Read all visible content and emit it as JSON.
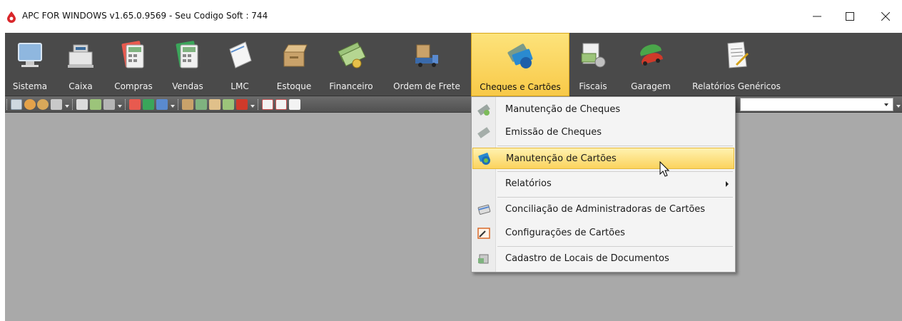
{
  "window": {
    "title": "APC FOR WINDOWS v1.65.0.9569 - Seu Codigo Soft : 744",
    "minimize_glyph": "—",
    "maximize_glyph": "☐",
    "close_glyph": "✕"
  },
  "ribbon": {
    "items": [
      {
        "label": "Sistema",
        "icon": "computer-icon"
      },
      {
        "label": "Caixa",
        "icon": "cash-register-icon"
      },
      {
        "label": "Compras",
        "icon": "calculator-icon"
      },
      {
        "label": "Vendas",
        "icon": "calculator-icon"
      },
      {
        "label": "LMC",
        "icon": "document-icon"
      },
      {
        "label": "Estoque",
        "icon": "box-icon"
      },
      {
        "label": "Financeiro",
        "icon": "money-icon"
      },
      {
        "label": "Ordem de Frete",
        "icon": "truck-icon"
      },
      {
        "label": "Cheques e Cartões",
        "icon": "cards-icon",
        "active": true
      },
      {
        "label": "Fiscais",
        "icon": "fiscal-documents-icon"
      },
      {
        "label": "Garagem",
        "icon": "cars-icon"
      },
      {
        "label": "Relatórios Genéricos",
        "icon": "report-icon"
      }
    ]
  },
  "menu": {
    "items": [
      {
        "label": "Manutenção de Cheques",
        "icon": "check-icon"
      },
      {
        "label": "Emissão de Cheques",
        "icon": "check-icon"
      },
      {
        "label": "Manutenção de Cartões",
        "icon": "card-globe-icon",
        "highlighted": true
      },
      {
        "label": "Relatórios",
        "icon": "",
        "submenu": true
      },
      {
        "label": "Conciliação de Administradoras de Cartões",
        "icon": "card-reconcile-icon"
      },
      {
        "label": "Configurações de Cartões",
        "icon": "card-settings-icon"
      },
      {
        "label": "Cadastro de Locais de Documentos",
        "icon": "document-location-icon"
      }
    ]
  },
  "colors": {
    "ribbon_bg": "#4a4a4a",
    "workspace_bg": "#a9a9a9",
    "highlight": "#fbd35e"
  }
}
